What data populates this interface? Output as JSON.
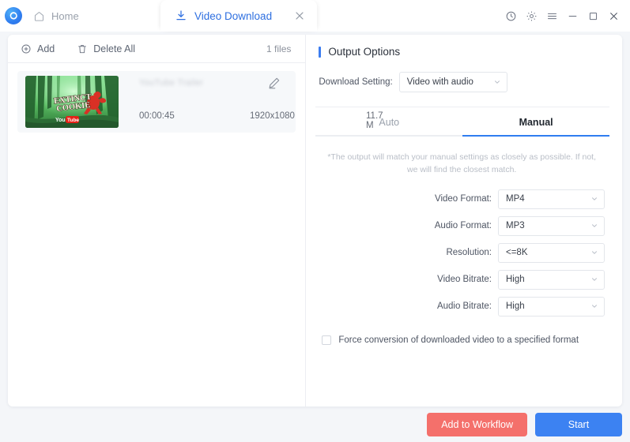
{
  "titlebar": {
    "logo_icon": "app-logo-swirl-icon",
    "home_tab": {
      "icon": "home-icon",
      "label": "Home"
    },
    "active_tab": {
      "icon": "download-icon",
      "label": "Video Download",
      "close_icon": "close-icon"
    },
    "controls": [
      {
        "name": "history-icon",
        "glyph": "clock"
      },
      {
        "name": "settings-gear-icon",
        "glyph": "gear"
      },
      {
        "name": "menu-icon",
        "glyph": "hamburger"
      },
      {
        "name": "minimize-icon",
        "glyph": "minimize"
      },
      {
        "name": "maximize-icon",
        "glyph": "maximize"
      },
      {
        "name": "close-window-icon",
        "glyph": "close"
      }
    ]
  },
  "left_pane": {
    "toolbar": {
      "add_label": "Add",
      "delete_all_label": "Delete All",
      "files_count": "1 files"
    },
    "items": [
      {
        "title": "YouTube Trailer",
        "duration": "00:00:45",
        "resolution": "1920x1080",
        "size": "11.7 M",
        "thumbnail_text_top": "EXTINCT",
        "thumbnail_text_bottom": "COOKIE",
        "thumbnail_brand_prefix": "You",
        "thumbnail_brand_suffix": "Tube",
        "edit_icon": "edit-pencil-icon"
      }
    ]
  },
  "right_pane": {
    "panel_title": "Output Options",
    "download_setting": {
      "label": "Download Setting:",
      "value": "Video with audio"
    },
    "tabs": [
      {
        "label": "Auto",
        "active": false
      },
      {
        "label": "Manual",
        "active": true
      }
    ],
    "note": "*The output will match your manual settings as closely as possible. If not, we will find the closest match.",
    "fields": [
      {
        "label": "Video Format:",
        "value": "MP4"
      },
      {
        "label": "Audio Format:",
        "value": "MP3"
      },
      {
        "label": "Resolution:",
        "value": "<=8K"
      },
      {
        "label": "Video Bitrate:",
        "value": "High"
      },
      {
        "label": "Audio Bitrate:",
        "value": "High"
      }
    ],
    "force_conversion": {
      "checked": false,
      "label": "Force conversion of downloaded video to a specified format"
    }
  },
  "footer": {
    "add_to_workflow_label": "Add to Workflow",
    "start_label": "Start"
  },
  "colors": {
    "accent_blue": "#3c7df0",
    "start_button": "#3c82f2",
    "workflow_button": "#f4706b",
    "tab_text_blue": "#2e6fe0"
  }
}
